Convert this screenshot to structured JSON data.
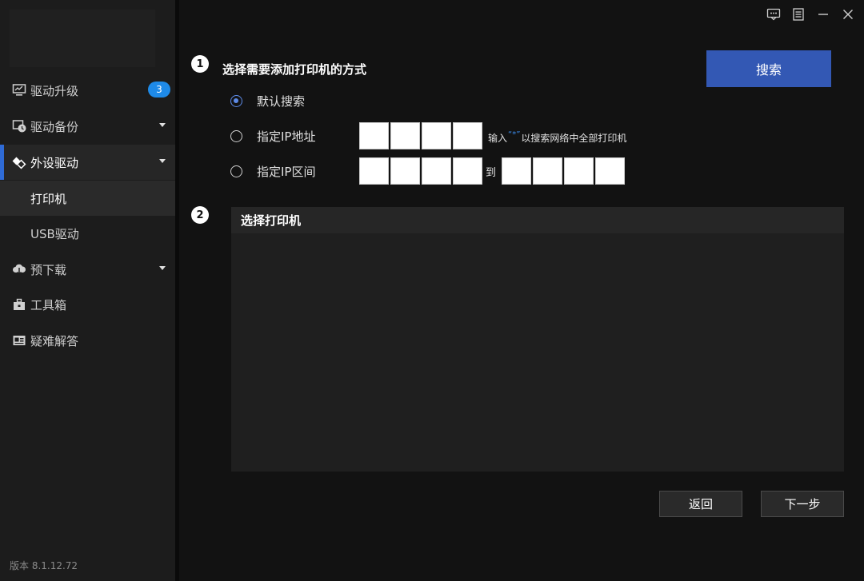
{
  "window_controls": {
    "feedback_icon": "chat-bubble-icon",
    "menu_icon": "list-icon",
    "minimize_icon": "minimize-icon",
    "close_icon": "close-icon"
  },
  "sidebar": {
    "items": [
      {
        "label": "驱动升级",
        "icon": "monitor-icon",
        "badge": "3"
      },
      {
        "label": "驱动备份",
        "icon": "backup-clock-icon"
      },
      {
        "label": "外设驱动",
        "icon": "peripheral-icon"
      },
      {
        "label": "预下载",
        "icon": "cloud-download-icon"
      },
      {
        "label": "工具箱",
        "icon": "toolbox-icon"
      },
      {
        "label": "疑难解答",
        "icon": "help-card-icon"
      }
    ],
    "sub_items": [
      {
        "label": "打印机"
      },
      {
        "label": "USB驱动"
      }
    ],
    "version": "版本 8.1.12.72"
  },
  "step1": {
    "number": "1",
    "title": "选择需要添加打印机的方式",
    "search_button": "搜索",
    "options": [
      {
        "label": "默认搜索",
        "checked": true
      },
      {
        "label": "指定IP地址",
        "checked": false
      },
      {
        "label": "指定IP区间",
        "checked": false
      }
    ],
    "hint_prefix": "输入",
    "hint_quote": "“*”",
    "hint_suffix": "以搜索网络中全部打印机",
    "range_to": "到"
  },
  "step2": {
    "number": "2",
    "panel_title": "选择打印机"
  },
  "footer": {
    "back_button": "返回",
    "next_button": "下一步"
  },
  "colors": {
    "accent": "#3358b4",
    "badge": "#1e8ae8",
    "active_indicator": "#2f6bd6"
  }
}
